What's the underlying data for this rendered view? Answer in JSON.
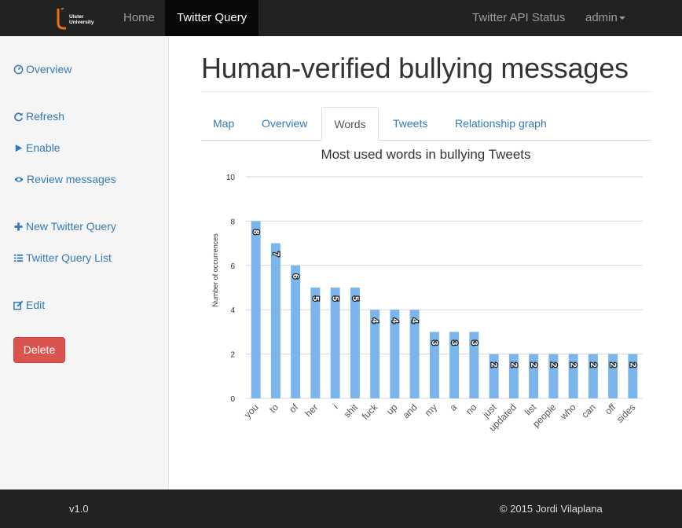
{
  "navbar": {
    "logo_line1": "Ulster",
    "logo_line2": "University",
    "home": "Home",
    "twitter_query": "Twitter Query",
    "api_status": "Twitter API Status",
    "admin": "admin"
  },
  "sidebar": {
    "overview": "Overview",
    "refresh": "Refresh",
    "enable": "Enable",
    "review": "Review messages",
    "new_query": "New Twitter Query",
    "query_list": "Twitter Query List",
    "edit": "Edit",
    "delete": "Delete"
  },
  "main": {
    "title": "Human-verified bullying messages",
    "tabs": [
      "Map",
      "Overview",
      "Words",
      "Tweets",
      "Relationship graph"
    ],
    "active_tab": "Words"
  },
  "colors": {
    "bar": "#7cb5ec",
    "delete": "#d9534f",
    "link": "#337ab7",
    "logo_accent": "#e8730e"
  },
  "chart_data": {
    "type": "bar",
    "title": "Most used words in bullying Tweets",
    "xlabel": "",
    "ylabel": "Number of occurrences",
    "ylim": [
      0,
      10
    ],
    "yticks": [
      0,
      2,
      4,
      6,
      8,
      10
    ],
    "grid": true,
    "categories": [
      "you",
      "to",
      "of",
      "her",
      "i",
      "shit",
      "fuck",
      "up",
      "and",
      "my",
      "a",
      "no",
      "just",
      "updated",
      "list",
      "people",
      "who",
      "can",
      "off",
      "sides"
    ],
    "values": [
      8,
      7,
      6,
      5,
      5,
      5,
      4,
      4,
      4,
      3,
      3,
      3,
      2,
      2,
      2,
      2,
      2,
      2,
      2,
      2
    ]
  },
  "footer": {
    "version": "v1.0",
    "copyright": "© 2015 Jordi Vilaplana"
  }
}
